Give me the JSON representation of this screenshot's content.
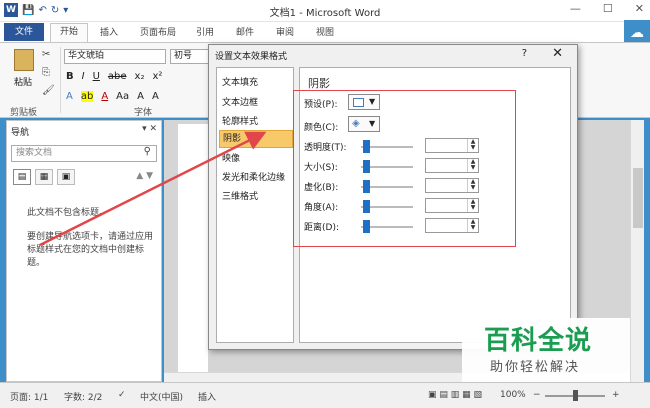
{
  "window": {
    "title": "文档1 - Microsoft Word",
    "controls": {
      "minimize": "—",
      "maximize": "☐",
      "close": "✕"
    }
  },
  "quick_access": {
    "save": "💾",
    "undo": "↶",
    "redo": "↻",
    "more": "▾"
  },
  "ribbon": {
    "tabs": [
      "文件",
      "开始",
      "插入",
      "页面布局",
      "引用",
      "邮件",
      "审阅",
      "视图"
    ],
    "paste_label": "粘贴",
    "clipboard_group": "剪贴板",
    "font_group": "字体",
    "font_name": "华文琥珀",
    "font_size": "初号",
    "format_row1": [
      "B",
      "I",
      "U",
      "abe",
      "x₂",
      "x²"
    ],
    "format_row2": [
      "A",
      "ab",
      "A",
      "Aa",
      "A",
      "A"
    ]
  },
  "nav": {
    "title": "导航",
    "search_placeholder": "搜索文档",
    "empty_message": "此文档不包含标题。",
    "hint": "要创建导航选项卡，请通过应用标题样式在您的文档中创建标题。"
  },
  "dialog": {
    "title": "设置文本效果格式",
    "help": "?",
    "close": "✕",
    "categories": [
      "文本填充",
      "文本边框",
      "轮廓样式",
      "阴影",
      "映像",
      "发光和柔化边缘",
      "三维格式"
    ],
    "selected_category": "阴影",
    "panel_title": "阴影",
    "options": {
      "preset": "预设(P):",
      "color": "颜色(C):",
      "transparency": "透明度(T):",
      "size": "大小(S):",
      "blur": "虚化(B):",
      "angle": "角度(A):",
      "distance": "距离(D):"
    }
  },
  "status": {
    "page": "页面: 1/1",
    "words": "字数: 2/2",
    "language": "中文(中国)",
    "mode": "插入",
    "zoom": "100%",
    "zoom_minus": "−",
    "zoom_plus": "+"
  },
  "watermark": {
    "main": "百科全说",
    "sub": "助你轻松解决"
  },
  "colors": {
    "accent": "#2b579a",
    "highlight": "#e0474a",
    "selection": "#f8c96b",
    "watermark": "#1a9d50"
  }
}
